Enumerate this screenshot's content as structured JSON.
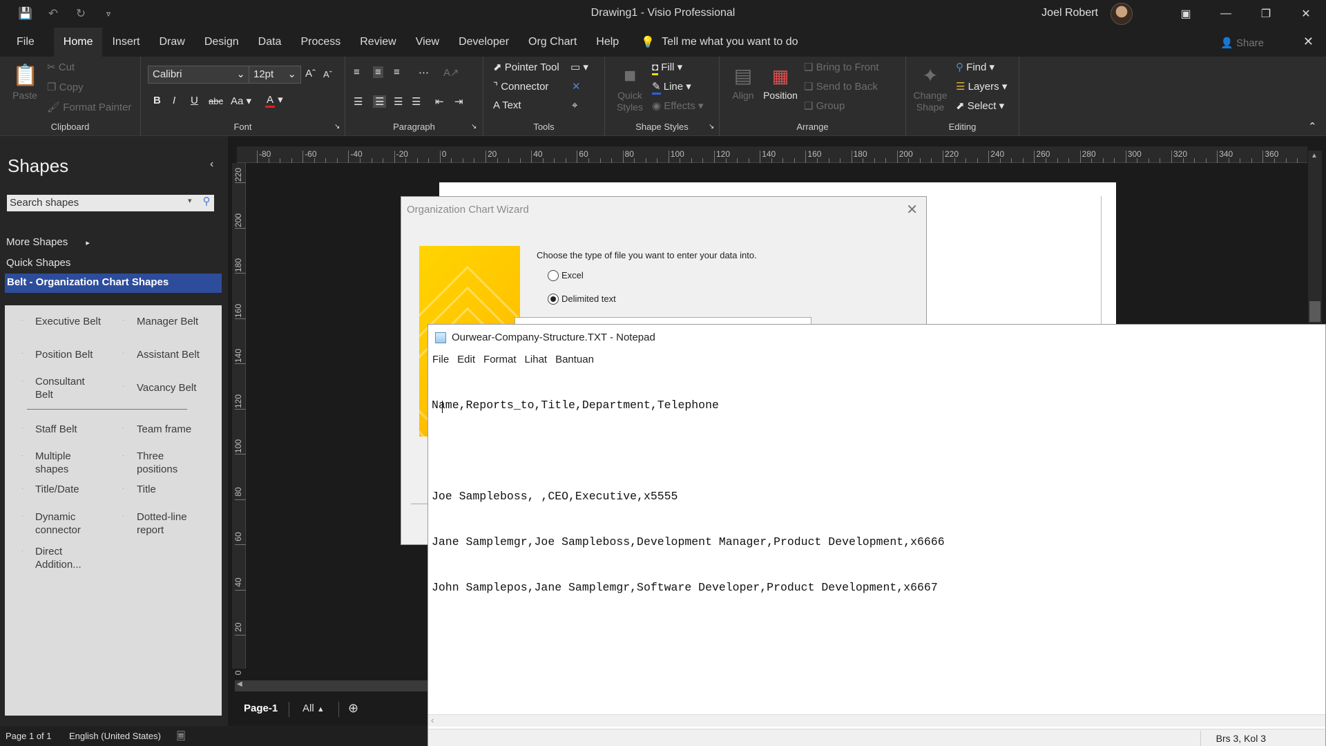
{
  "window": {
    "title": "Drawing1  -  Visio Professional",
    "user_name": "Joel Robert",
    "share_label": "Share"
  },
  "ribbon_tabs": [
    "File",
    "Home",
    "Insert",
    "Draw",
    "Design",
    "Data",
    "Process",
    "Review",
    "View",
    "Developer",
    "Org Chart",
    "Help"
  ],
  "active_tab": "Home",
  "tell_me": "Tell me what you want to do",
  "clipboard": {
    "paste": "Paste",
    "cut": "Cut",
    "copy": "Copy",
    "format_painter": "Format Painter",
    "label": "Clipboard"
  },
  "font": {
    "family": "Calibri",
    "size": "12pt",
    "bold": "B",
    "italic": "I",
    "underline": "U",
    "strike": "abc",
    "case": "Aa",
    "color": "A",
    "label": "Font"
  },
  "paragraph": {
    "label": "Paragraph"
  },
  "tools": {
    "pointer": "Pointer Tool",
    "connector": "Connector",
    "text": "Text",
    "label": "Tools"
  },
  "shape_styles": {
    "quick_styles": "Quick Styles",
    "fill": "Fill",
    "line": "Line",
    "effects": "Effects",
    "label": "Shape Styles"
  },
  "arrange": {
    "align": "Align",
    "position": "Position",
    "bring_front": "Bring to Front",
    "send_back": "Send to Back",
    "group": "Group",
    "label": "Arrange"
  },
  "editing": {
    "change_shape": "Change Shape",
    "find": "Find",
    "layers": "Layers",
    "select": "Select",
    "label": "Editing"
  },
  "shapes_pane": {
    "title": "Shapes",
    "search_placeholder": "Search shapes",
    "more_shapes": "More Shapes",
    "quick_shapes": "Quick Shapes",
    "selected_stencil": "Belt - Organization Chart Shapes",
    "items_left": [
      "Executive Belt",
      "Position Belt",
      "Consultant Belt",
      "Staff Belt",
      "Multiple shapes",
      "Title/Date",
      "Dynamic connector",
      "Direct Addition..."
    ],
    "items_right": [
      "Manager Belt",
      "Assistant Belt",
      "Vacancy Belt",
      "Team frame",
      "Three positions",
      "Title",
      "Dotted-line report"
    ]
  },
  "ruler_top": [
    "-80",
    "-60",
    "-40",
    "-20",
    "0",
    "20",
    "40",
    "60",
    "80",
    "100",
    "120",
    "140",
    "160",
    "180",
    "200",
    "220",
    "240",
    "260",
    "280",
    "300",
    "320",
    "340",
    "360"
  ],
  "ruler_left": [
    "220",
    "200",
    "180",
    "160",
    "140",
    "120",
    "100",
    "80",
    "60",
    "40",
    "20",
    "0"
  ],
  "page_tabs": {
    "page": "Page-1",
    "all": "All"
  },
  "status": {
    "page": "Page 1 of 1",
    "language": "English (United States)"
  },
  "wizard": {
    "title": "Organization Chart Wizard",
    "prompt": "Choose the type of file you want to enter your data into.",
    "option_excel": "Excel",
    "option_delimited": "Delimited text",
    "selected": "Delimited text"
  },
  "notepad": {
    "title": "Ourwear-Company-Structure.TXT - Notepad",
    "menu": [
      "File",
      "Edit",
      "Format",
      "Lihat",
      "Bantuan"
    ],
    "lines": [
      "Name,Reports_to,Title,Department,Telephone",
      "",
      "Joe Sampleboss, ,CEO,Executive,x5555",
      "Jane Samplemgr,Joe Sampleboss,Development Manager,Product Development,x6666",
      "John Samplepos,Jane Samplemgr,Software Developer,Product Development,x6667"
    ],
    "status": "Brs 3, Kol 3"
  }
}
